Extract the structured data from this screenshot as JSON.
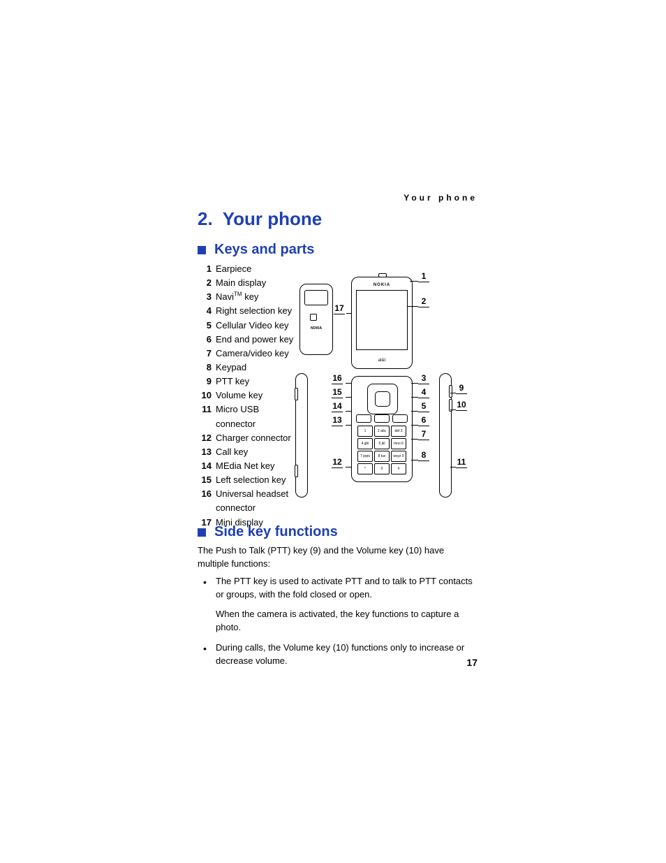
{
  "running_head": "Your phone",
  "chapter": {
    "number": "2.",
    "title": "Your phone"
  },
  "sections": {
    "keys_and_parts": {
      "heading": "Keys and parts",
      "items": [
        {
          "n": "1",
          "label": "Earpiece"
        },
        {
          "n": "2",
          "label": "Main display"
        },
        {
          "n": "3",
          "label_html": "Navi<sup>TM</sup> key",
          "label": "NaviTM key"
        },
        {
          "n": "4",
          "label": "Right selection key"
        },
        {
          "n": "5",
          "label": "Cellular Video key"
        },
        {
          "n": "6",
          "label": "End and power key"
        },
        {
          "n": "7",
          "label": "Camera/video key"
        },
        {
          "n": "8",
          "label": "Keypad"
        },
        {
          "n": "9",
          "label": "PTT key"
        },
        {
          "n": "10",
          "label": "Volume key"
        },
        {
          "n": "11",
          "label": "Micro USB connector"
        },
        {
          "n": "12",
          "label": "Charger connector"
        },
        {
          "n": "13",
          "label": "Call key"
        },
        {
          "n": "14",
          "label": "MEdia Net key"
        },
        {
          "n": "15",
          "label": "Left selection key"
        },
        {
          "n": "16",
          "label": "Universal headset connector"
        },
        {
          "n": "17",
          "label": "Mini display"
        }
      ]
    },
    "side_key_functions": {
      "heading": "Side key functions",
      "intro": "The Push to Talk (PTT) key (9) and the Volume key (10) have multiple functions:",
      "bullets": [
        {
          "text": "The PTT key is used to activate PTT and to talk to PTT contacts or groups, with the fold closed or open.",
          "sub": "When the camera is activated, the key functions to capture a photo."
        },
        {
          "text": "During calls, the Volume key (10) functions only to increase or decrease volume."
        }
      ]
    }
  },
  "diagram": {
    "brand": "NOKIA",
    "carrier": "at&t",
    "outer_brand": "NOKIA",
    "keypad_keys": [
      "1",
      "2 abc",
      "def 3",
      "4 ghi",
      "5 jkl",
      "mno 6",
      "7 pqrs",
      "8 tuv",
      "wxyz 9",
      "*",
      "0",
      "#"
    ],
    "callouts_right_top": [
      {
        "n": "1"
      },
      {
        "n": "2"
      }
    ],
    "callouts_right_bottom": [
      {
        "n": "3"
      },
      {
        "n": "4"
      },
      {
        "n": "5"
      },
      {
        "n": "6"
      },
      {
        "n": "7"
      },
      {
        "n": "8"
      }
    ],
    "callouts_far_right": [
      {
        "n": "9"
      },
      {
        "n": "10"
      },
      {
        "n": "11"
      }
    ],
    "callouts_left": [
      {
        "n": "17"
      }
    ],
    "callouts_left_bottom": [
      {
        "n": "16"
      },
      {
        "n": "15"
      },
      {
        "n": "14"
      },
      {
        "n": "13"
      },
      {
        "n": "12"
      }
    ]
  },
  "page_number": "17"
}
